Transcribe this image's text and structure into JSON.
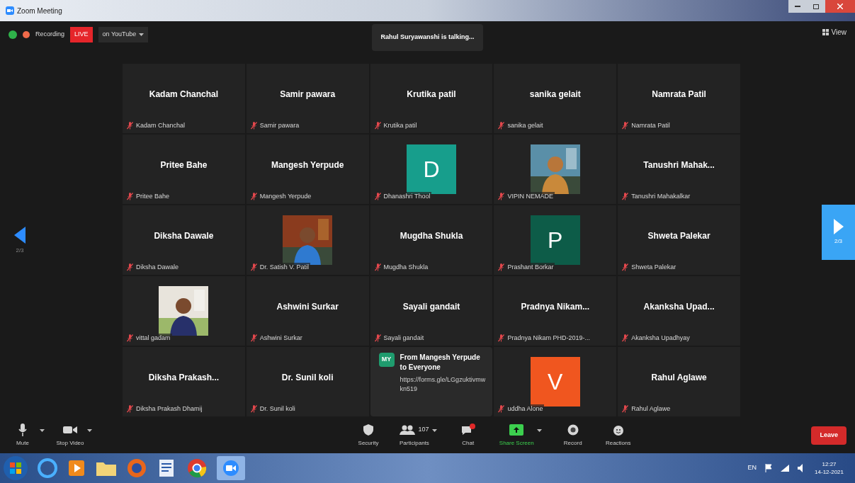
{
  "window": {
    "title": "Zoom Meeting"
  },
  "top_bar": {
    "recording": "Recording",
    "live_badge": "LIVE",
    "live_target": "on YouTube",
    "talking": "Rahul Suryawanshi is talking...",
    "view": "View"
  },
  "pager": {
    "left": "2/3",
    "right": "2/3"
  },
  "tiles": [
    {
      "kind": "name",
      "title": "Kadam Chanchal",
      "label": "Kadam Chanchal"
    },
    {
      "kind": "name",
      "title": "Samir pawara",
      "label": "Samir pawara"
    },
    {
      "kind": "name",
      "title": "Krutika patil",
      "label": "Krutika patil"
    },
    {
      "kind": "name",
      "title": "sanika gelait",
      "label": "sanika gelait"
    },
    {
      "kind": "name",
      "title": "Namrata Patil",
      "label": "Namrata Patil"
    },
    {
      "kind": "name",
      "title": "Pritee Bahe",
      "label": "Pritee Bahe"
    },
    {
      "kind": "name",
      "title": "Mangesh Yerpude",
      "label": "Mangesh Yerpude"
    },
    {
      "kind": "letter",
      "letter": "D",
      "color": "#179e8c",
      "label": "Dhanashri Thool"
    },
    {
      "label": "VIPIN NEMADE"
    },
    {
      "kind": "name",
      "title": "Tanushri  Mahak...",
      "label": "Tanushri Mahakalkar"
    },
    {
      "kind": "name",
      "title": "Diksha Dawale",
      "label": "Diksha Dawale"
    },
    {
      "label": "Dr. Satish V. Patil"
    },
    {
      "kind": "name",
      "title": "Mugdha Shukla",
      "label": "Mugdha Shukla"
    },
    {
      "kind": "letter",
      "letter": "P",
      "color": "#0d5c48",
      "label": "Prashant Borkar"
    },
    {
      "kind": "name",
      "title": "Shweta Palekar",
      "label": "Shweta Palekar"
    },
    {
      "label": "vittal gadam"
    },
    {
      "kind": "name",
      "title": "Ashwini Surkar",
      "label": "Ashwini Surkar"
    },
    {
      "kind": "name",
      "title": "Sayali gandait",
      "label": "Sayali gandait"
    },
    {
      "kind": "name",
      "title": "Pradnya  Nikam...",
      "label": "Pradnya Nikam PHD-2019-..."
    },
    {
      "kind": "name",
      "title": "Akanksha  Upad...",
      "label": "Akanksha Upadhyay"
    },
    {
      "kind": "name",
      "title": "Diksha  Prakash...",
      "label": "Diksha Prakash Dhamij"
    },
    {
      "kind": "name",
      "title": "Dr. Sunil koli",
      "label": "Dr. Sunil koli"
    },
    {
      "kind": "chat",
      "initials": "MY",
      "heading": "From Mangesh Yerpude to Everyone",
      "message": "https://forms.gle/LGgzuktivmwkn519"
    },
    {
      "kind": "letter",
      "letter": "V",
      "color": "#f0561f",
      "label": "uddha Alone"
    },
    {
      "kind": "name",
      "title": "Rahul Aglawe",
      "label": "Rahul Aglawe"
    }
  ],
  "toolbar": [
    {
      "kind": "mic",
      "label": "Mute"
    },
    {
      "kind": "video",
      "label": "Stop Video"
    },
    {
      "kind": "security",
      "label": "Security"
    },
    {
      "kind": "participants",
      "label": "Participants",
      "count": "107"
    },
    {
      "kind": "chat",
      "label": "Chat"
    },
    {
      "kind": "share",
      "label": "Share Screen"
    },
    {
      "kind": "record",
      "label": "Record"
    },
    {
      "kind": "reactions",
      "label": "Reactions"
    }
  ],
  "leave": "Leave",
  "taskbar": {
    "language": "EN",
    "time": "12:27",
    "date": "14-12-2021"
  }
}
